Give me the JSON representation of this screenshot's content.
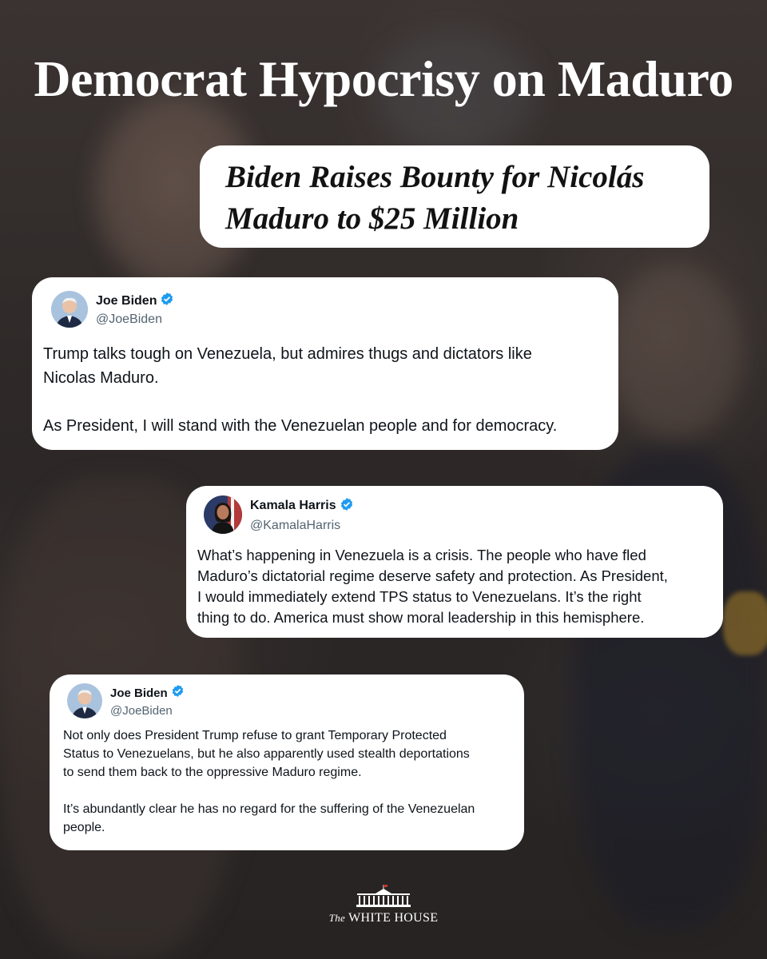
{
  "title": "Democrat Hypocrisy on Maduro",
  "headline": {
    "line1": "Biden Raises Bounty for Nicolás",
    "line2": "Maduro to $25 Million"
  },
  "tweets": [
    {
      "name": "Joe Biden",
      "handle": "@JoeBiden",
      "avatar_icon": "person-avatar-icon",
      "verified_icon": "verified-badge-icon",
      "text": "Trump talks tough on Venezuela, but admires thugs and dictators like\nNicolas Maduro.\n\nAs President, I will stand with the Venezuelan people and for democracy."
    },
    {
      "name": "Kamala Harris",
      "handle": "@KamalaHarris",
      "avatar_icon": "person-avatar-icon",
      "verified_icon": "verified-badge-icon",
      "text": "What’s happening in Venezuela is a crisis. The people who have fled\nMaduro’s dictatorial regime deserve safety and protection. As President,\nI would immediately extend TPS status to Venezuelans. It’s the right\nthing to do. America must show moral leadership in this hemisphere."
    },
    {
      "name": "Joe Biden",
      "handle": "@JoeBiden",
      "avatar_icon": "person-avatar-icon",
      "verified_icon": "verified-badge-icon",
      "text": "Not only does President Trump refuse to grant Temporary Protected\nStatus to Venezuelans, but he also apparently used stealth deportations\nto send them back to the oppressive Maduro regime.\n\nIt’s abundantly clear he has no regard for the suffering of the Venezuelan\npeople."
    }
  ],
  "footer": {
    "the": "The",
    "name": "WHITE HOUSE",
    "logo_icon": "white-house-icon"
  },
  "colors": {
    "verified": "#1d9bf0",
    "handle": "#536471",
    "text": "#0f1419"
  }
}
